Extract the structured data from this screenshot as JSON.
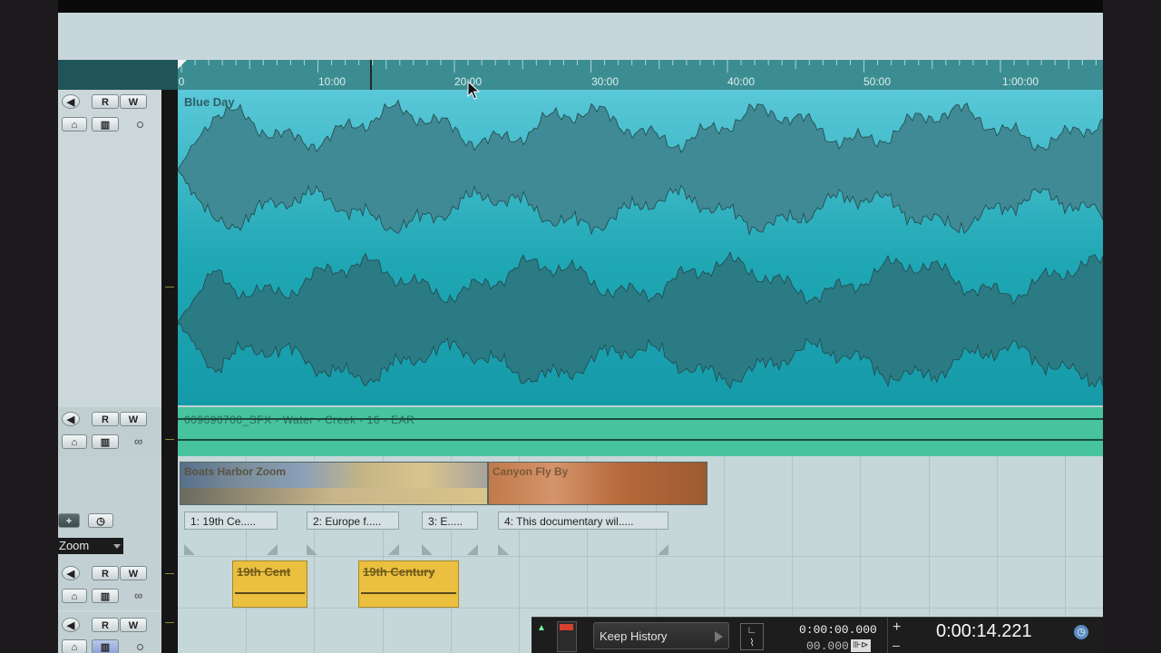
{
  "ruler": {
    "ticks": [
      "0",
      "10:00",
      "20:00",
      "30:00",
      "40:00",
      "50:00",
      "1:00:00"
    ]
  },
  "tracks": {
    "audio_main": {
      "name": "Blue Day"
    },
    "audio_sfx": {
      "name": "009690700_SFX - Water - Creek - 16 - EAR"
    },
    "video": {
      "clip1": "Boats Harbor Zoom",
      "clip2": "Canyon Fly By"
    },
    "markers": [
      "1: 19th Ce.....",
      "2: Europe f.....",
      "3: E.....",
      "4: This documentary wil....."
    ],
    "midi": {
      "clip1": "19th Cent",
      "clip2": "19th Century"
    }
  },
  "header_buttons": {
    "read": "R",
    "write": "W"
  },
  "ruler_header": {
    "zoom_select": "Zoom"
  },
  "transport": {
    "history": "Keep History",
    "time_primary": "0:00:00.000",
    "time_secondary": "00.000",
    "position": "0:00:14.221",
    "plus": "+"
  }
}
